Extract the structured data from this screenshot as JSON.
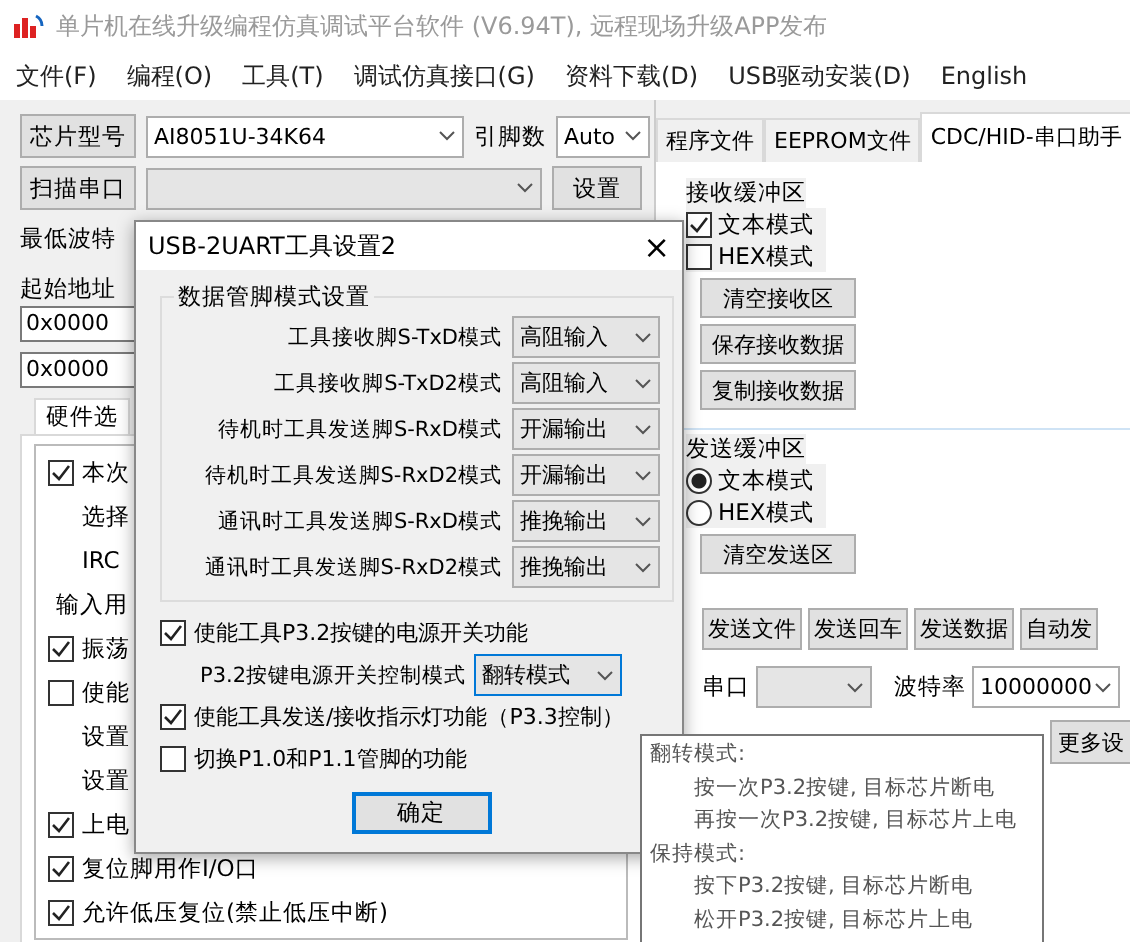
{
  "window": {
    "title": "单片机在线升级编程仿真调试平台软件 (V6.94T), 远程现场升级APP发布"
  },
  "menu": [
    "文件(F)",
    "编程(O)",
    "工具(T)",
    "调试仿真接口(G)",
    "资料下载(D)",
    "USB驱动安装(D)",
    "English"
  ],
  "chip": {
    "button": "芯片型号",
    "value": "AI8051U-34K64",
    "pins_label": "引脚数",
    "pins_value": "Auto"
  },
  "port": {
    "button": "扫描串口",
    "settings_button": "设置"
  },
  "min_baud_label": "最低波特",
  "start_address": {
    "label": "起始地址",
    "fields": [
      "0x0000",
      "0x0000"
    ]
  },
  "hardware_tab": "硬件选",
  "hardware_options": [
    {
      "kind": "check",
      "label": "本次",
      "checked": true
    },
    {
      "kind": "sub",
      "label": "选择"
    },
    {
      "kind": "sub",
      "label": "IRC"
    },
    {
      "kind": "text",
      "label": "输入用"
    },
    {
      "kind": "check",
      "label": "振荡",
      "checked": true
    },
    {
      "kind": "check",
      "label": "使能",
      "checked": false
    },
    {
      "kind": "sub",
      "label": "设置"
    },
    {
      "kind": "sub",
      "label": "设置"
    },
    {
      "kind": "check",
      "label": "上电",
      "checked": true
    },
    {
      "kind": "check",
      "label": "复位脚用作I/O口",
      "checked": true
    },
    {
      "kind": "check",
      "label": "允许低压复位(禁止低压中断)",
      "checked": true
    }
  ],
  "tabs": [
    {
      "label": "程序文件",
      "selected": false
    },
    {
      "label": "EEPROM文件",
      "selected": false
    },
    {
      "label": "CDC/HID-串口助手",
      "selected": true
    }
  ],
  "receive": {
    "title": "接收缓冲区",
    "options": [
      {
        "label": "文本模式",
        "checked": true
      },
      {
        "label": "HEX模式",
        "checked": false
      }
    ],
    "buttons": [
      "清空接收区",
      "保存接收数据",
      "复制接收数据"
    ]
  },
  "send": {
    "title": "发送缓冲区",
    "modes": [
      {
        "label": "文本模式",
        "selected": true
      },
      {
        "label": "HEX模式",
        "selected": false
      }
    ],
    "buttons": [
      "清空发送区"
    ]
  },
  "action_buttons": [
    "发送文件",
    "发送回车",
    "发送数据",
    "自动发"
  ],
  "serial": {
    "port_label": "串口",
    "baud_label": "波特率",
    "baud_value": "10000000"
  },
  "more_button": "更多设",
  "dialog": {
    "title": "USB-2UART工具设置2",
    "close": "×",
    "group_title": "数据管脚模式设置",
    "pin_modes": [
      {
        "label": "工具接收脚S-TxD模式",
        "value": "高阻输入"
      },
      {
        "label": "工具接收脚S-TxD2模式",
        "value": "高阻输入"
      },
      {
        "label": "待机时工具发送脚S-RxD模式",
        "value": "开漏输出"
      },
      {
        "label": "待机时工具发送脚S-RxD2模式",
        "value": "开漏输出"
      },
      {
        "label": "通讯时工具发送脚S-RxD模式",
        "value": "推挽输出"
      },
      {
        "label": "通讯时工具发送脚S-RxD2模式",
        "value": "推挽输出"
      }
    ],
    "options": [
      {
        "kind": "check",
        "label": "使能工具P3.2按键的电源开关功能",
        "checked": true
      },
      {
        "kind": "select",
        "label": "P3.2按键电源开关控制模式",
        "value": "翻转模式"
      },
      {
        "kind": "check",
        "label": "使能工具发送/接收指示灯功能（P3.3控制）",
        "checked": true
      },
      {
        "kind": "check",
        "label": "切换P1.0和P1.1管脚的功能",
        "checked": false
      }
    ],
    "ok": "确定"
  },
  "tooltip": [
    {
      "kind": "heading",
      "text": "翻转模式:"
    },
    {
      "kind": "item",
      "text": "按一次P3.2按键, 目标芯片断电"
    },
    {
      "kind": "item",
      "text": "再按一次P3.2按键, 目标芯片上电"
    },
    {
      "kind": "heading",
      "text": "保持模式:"
    },
    {
      "kind": "item",
      "text": "按下P3.2按键, 目标芯片断电"
    },
    {
      "kind": "item",
      "text": "松开P3.2按键, 目标芯片上电"
    }
  ]
}
